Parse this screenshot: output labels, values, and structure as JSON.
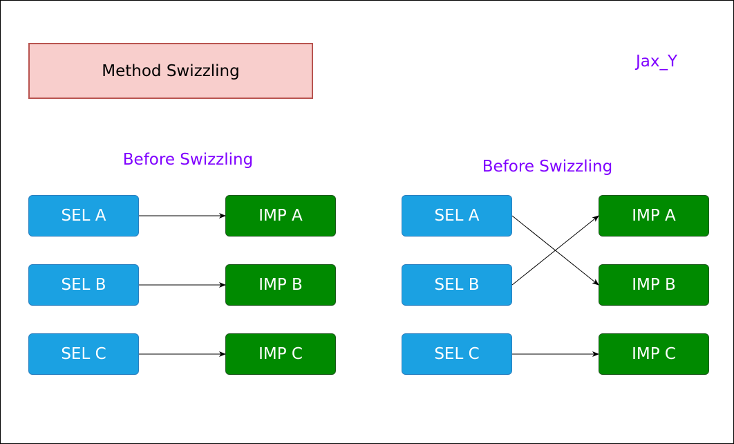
{
  "diagram": {
    "title": "Method Swizzling",
    "author": "Jax_Y",
    "colors": {
      "title_fill": "#f8cecc",
      "title_stroke": "#b85450",
      "selector_fill": "#1ba1e2",
      "implementation_fill": "#008a00",
      "heading_text": "#7f00ff",
      "arrow": "#000000"
    },
    "panels": [
      {
        "heading": "Before Swizzling",
        "selectors": [
          "SEL A",
          "SEL B",
          "SEL C"
        ],
        "implementations": [
          "IMP A",
          "IMP B",
          "IMP C"
        ],
        "edges": [
          {
            "from": "SEL A",
            "to": "IMP A"
          },
          {
            "from": "SEL B",
            "to": "IMP B"
          },
          {
            "from": "SEL C",
            "to": "IMP C"
          }
        ]
      },
      {
        "heading": "Before Swizzling",
        "selectors": [
          "SEL A",
          "SEL B",
          "SEL C"
        ],
        "implementations": [
          "IMP A",
          "IMP B",
          "IMP C"
        ],
        "edges": [
          {
            "from": "SEL A",
            "to": "IMP B"
          },
          {
            "from": "SEL B",
            "to": "IMP A"
          },
          {
            "from": "SEL C",
            "to": "IMP C"
          }
        ]
      }
    ]
  }
}
